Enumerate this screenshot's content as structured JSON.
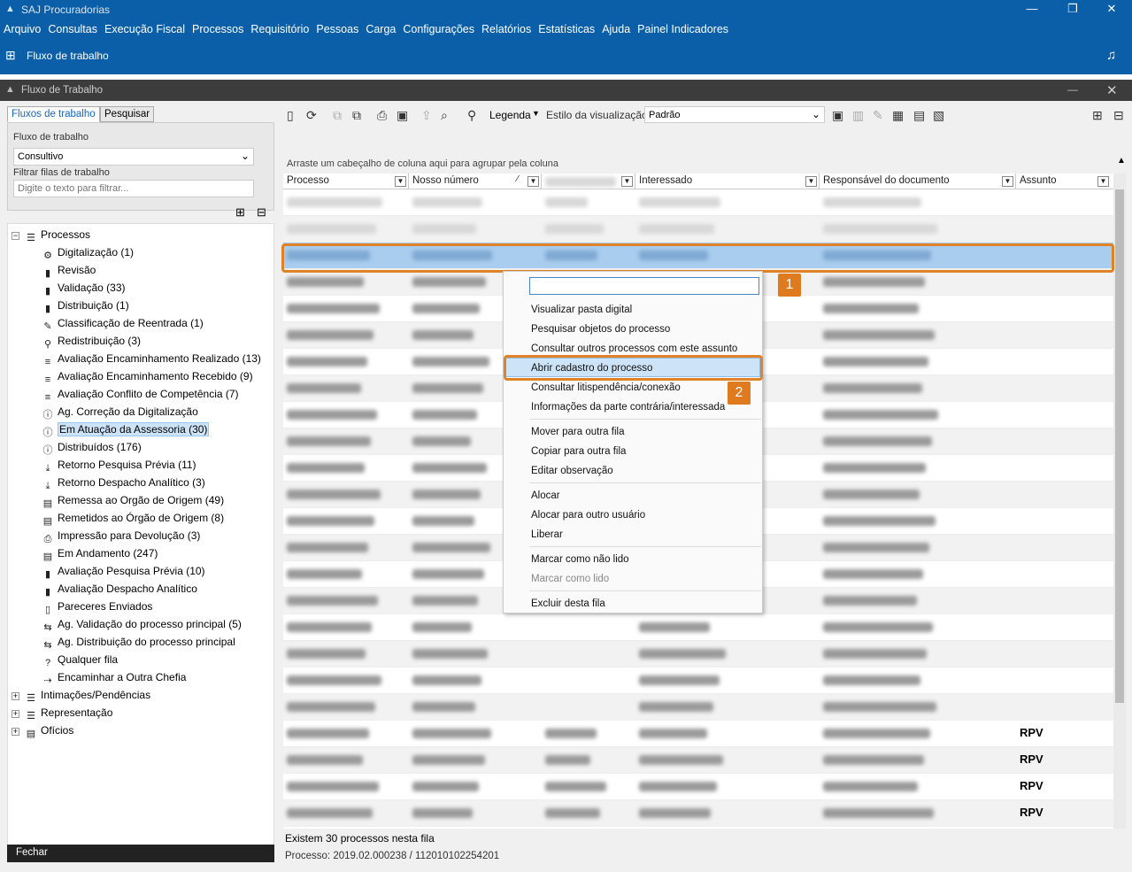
{
  "app": {
    "title": "SAJ Procuradorias"
  },
  "menu": [
    "Arquivo",
    "Consultas",
    "Execução Fiscal",
    "Processos",
    "Requisitório",
    "Pessoas",
    "Carga",
    "Configurações",
    "Relatórios",
    "Estatísticas",
    "Ajuda",
    "Painel Indicadores"
  ],
  "toolbar": {
    "workflow_label": "Fluxo de trabalho"
  },
  "window": {
    "title": "Fluxo de Trabalho"
  },
  "left": {
    "tabs": [
      "Fluxos de trabalho",
      "Pesquisar"
    ],
    "flow_label": "Fluxo de trabalho",
    "flow_value": "Consultivo",
    "filter_label": "Filtrar filas de trabalho",
    "filter_placeholder": "Digite o texto para filtrar...",
    "close_label": "Fechar"
  },
  "tree": {
    "root": "Processos",
    "items": [
      "Digitalização (1)",
      "Revisão",
      "Validação (33)",
      "Distribuição (1)",
      "Classificação de Reentrada (1)",
      "Redistribuição (3)",
      "Avaliação Encaminhamento Realizado (13)",
      "Avaliação Encaminhamento Recebido (9)",
      "Avaliação Conflito de Competência (7)",
      "Ag. Correção da Digitalização",
      "Em Atuação da Assessoria (30)",
      "Distribuídos (176)",
      "Retorno Pesquisa Prévia (11)",
      "Retorno Despacho Analítico (3)",
      "Remessa ao Orgão de Origem (49)",
      "Remetidos ao Órgão de Origem (8)",
      "Impressão para Devolução (3)",
      "Em Andamento (247)",
      "Avaliação Pesquisa Prévia (10)",
      "Avaliação Despacho Analítico",
      "Pareceres Enviados",
      "Ag. Validação do processo principal (5)",
      "Ag. Distribuição do processo principal",
      "Qualquer fila",
      "Encaminhar a Outra Chefia"
    ],
    "others": [
      "Intimações/Pendências",
      "Representação",
      "Ofícios"
    ]
  },
  "grid_toolbar": {
    "legend": "Legenda",
    "view_style_label": "Estilo da visualização",
    "view_style_value": "Padrão"
  },
  "grid": {
    "group_hint": "Arraste um cabeçalho de coluna aqui para agrupar pela coluna",
    "columns": [
      "Processo",
      "Nosso número",
      "Interessado",
      "Responsável do documento",
      "Assunto"
    ],
    "rpv_label": "RPV"
  },
  "status": {
    "count": "Existem 30 processos nesta fila",
    "current": "Processo: 2019.02.000238 / 112010102254201"
  },
  "context_menu": {
    "items": [
      "Visualizar pasta digital",
      "Pesquisar objetos do processo",
      "Consultar outros processos com este assunto",
      "Abrir cadastro do processo",
      "Consultar litispendência/conexão",
      "Informações da parte contrária/interessada",
      "Mover para outra fila",
      "Copiar para outra fila",
      "Editar observação",
      "Alocar",
      "Alocar para outro usuário",
      "Liberar",
      "Marcar como não lido",
      "Marcar como lido",
      "Excluir desta fila"
    ]
  },
  "callouts": [
    "1",
    "2"
  ]
}
